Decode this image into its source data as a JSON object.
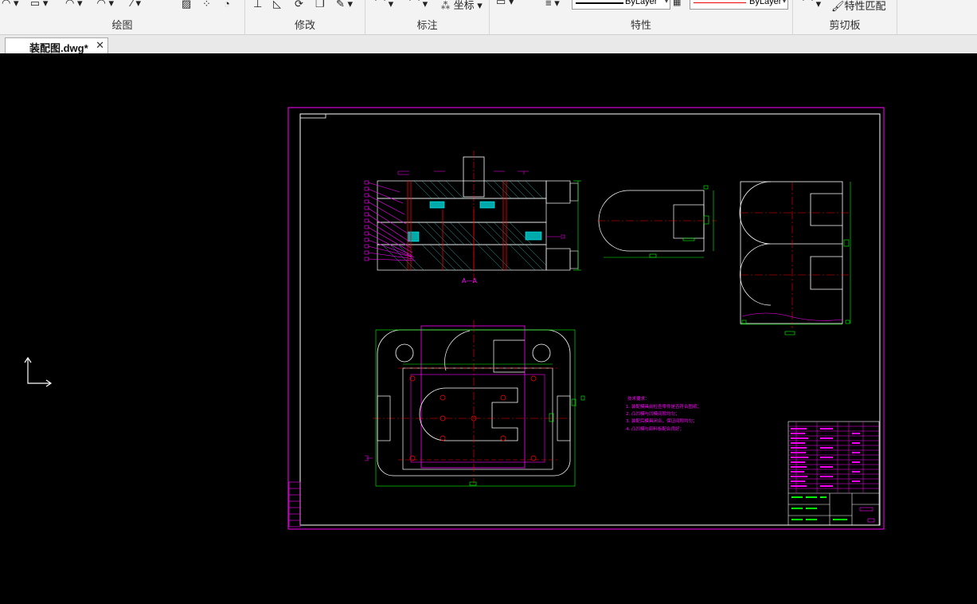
{
  "ribbon": {
    "groups": [
      {
        "label": "绘图"
      },
      {
        "label": "修改"
      },
      {
        "label": "标注"
      },
      {
        "label": "特性"
      },
      {
        "label": "剪切板"
      }
    ],
    "coordinate_label": "坐标",
    "properties": {
      "linetype_value": "ByLayer",
      "color_value": "ByLayer"
    },
    "match_properties_label": "特性匹配"
  },
  "tabs": [
    {
      "label": "装配图.dwg*",
      "active": true,
      "close_icon": "close-icon"
    }
  ],
  "drawing": {
    "section_label": "A—A",
    "technical_requirements": [
      "技术要求：",
      "1. 装配模具前检查零件是否符合图纸；",
      "2. 凸凹模与凹模间隙均匀；",
      "3. 装配后模具闭合，保证间隙均匀；",
      "4. 凸凹模与卸料板配合良好；"
    ]
  },
  "colors": {
    "ribbon_bg": "#f3f3f3",
    "canvas_bg": "#000000",
    "frame": "#ff00ff",
    "outline": "#ffffff",
    "dimension": "#00ff00",
    "centerline": "#ff0000",
    "hatch": "#00ffff"
  }
}
